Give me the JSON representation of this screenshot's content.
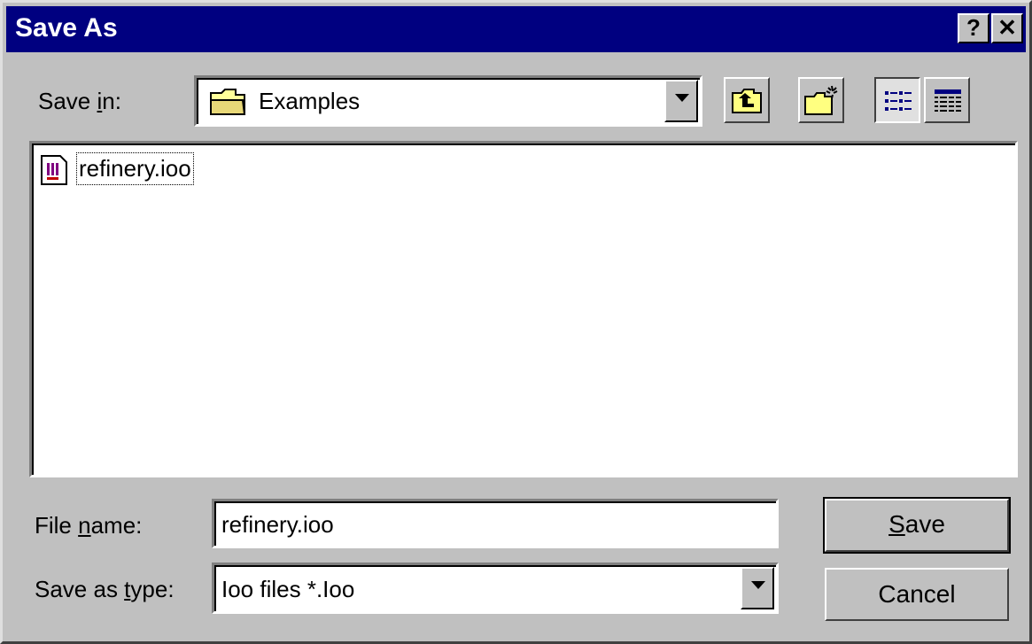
{
  "window": {
    "title": "Save As",
    "help_label": "?",
    "close_label": "✕"
  },
  "save_in": {
    "label_prefix": "Save ",
    "label_accel": "i",
    "label_suffix": "n:",
    "value": "Examples"
  },
  "toolbar": {
    "up_folder_icon": "up-folder-icon",
    "new_folder_icon": "new-folder-icon",
    "list_view_icon": "list-view-icon",
    "details_view_icon": "details-view-icon"
  },
  "files": [
    {
      "name": "refinery.ioo",
      "icon": "document-icon"
    }
  ],
  "file_name": {
    "label_prefix": "File ",
    "label_accel": "n",
    "label_suffix": "ame:",
    "value": "refinery.ioo"
  },
  "save_as_type": {
    "label_prefix": "Save as ",
    "label_accel": "t",
    "label_suffix": "ype:",
    "value": "Ioo files *.Ioo"
  },
  "buttons": {
    "save_accel": "S",
    "save_rest": "ave",
    "cancel": "Cancel"
  },
  "colors": {
    "titlebar": "#000080",
    "face": "#c0c0c0"
  }
}
